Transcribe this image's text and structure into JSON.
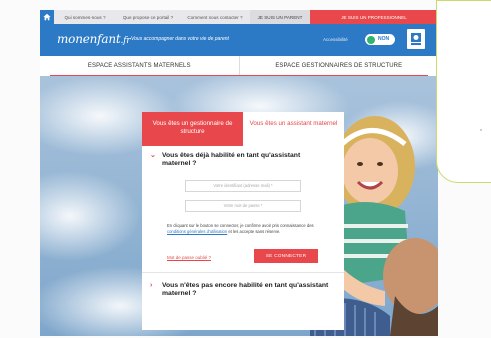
{
  "topnav": {
    "links": [
      "Qui sommes-nous ?",
      "Que propose ce portail ?",
      "Comment nous contacter ?",
      "JE SUIS UN PARENT",
      "JE SUIS UN PROFESSIONNEL"
    ]
  },
  "header": {
    "logo": "monenfant",
    "logo_suffix": ".fr",
    "tagline": "Vous accompagner dans votre vie de parent",
    "accessibility_label": "Accessibilité",
    "accessibility_toggle": "NON"
  },
  "spaces": {
    "tabs": [
      "ESPACE ASSISTANTS MATERNELS",
      "ESPACE GESTIONNAIRES DE STRUCTURE"
    ]
  },
  "login": {
    "tab_gestionnaire": "Vous êtes un gestionnaire de structure",
    "tab_assistant": "Vous êtes un assistant maternel",
    "question_habilite": "Vous êtes déjà habilité en tant qu'assistant maternel ?",
    "identifier_placeholder": "Votre identifiant (adresse mail) *",
    "password_placeholder": "Votre mot de passe *",
    "terms_before": "En cliquant sur le bouton se connecter, je confirme avoir pris connaissance des ",
    "terms_link": "conditions générales d'utilisation",
    "terms_after": " et les accepte sans réserve.",
    "forgot_password": "Mot de passe oublié ?",
    "connect_button": "SE CONNECTER",
    "question_not_habilite": "Vous n'êtes pas encore habilité en tant qu'assistant maternel ?"
  },
  "colors": {
    "brand_blue": "#2c79c6",
    "accent_red": "#e8474b",
    "toggle_green": "#2fb36d",
    "callout_border": "#c9dc6b"
  }
}
